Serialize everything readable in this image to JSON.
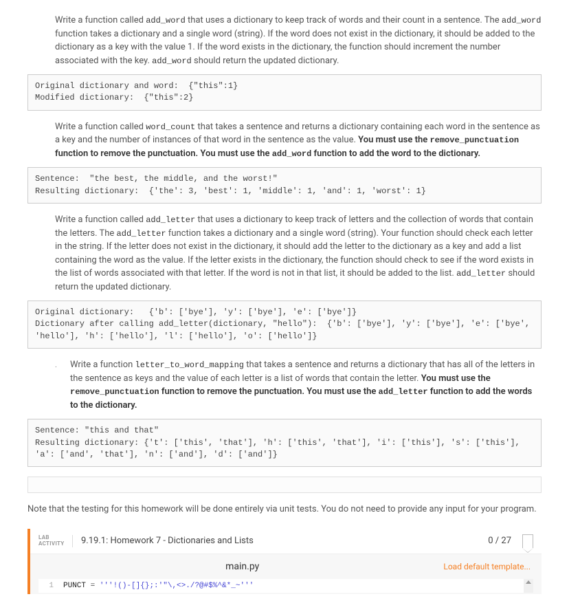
{
  "task1": {
    "text_pre1": "Write a function called ",
    "fn": "add_word",
    "text_mid1": " that uses a dictionary to keep track of words and their count in a sentence. The ",
    "fn2": "add_word",
    "text_mid2": " function takes a dictionary and a single word (string). If the word does not exist in the dictionary, it should be added to the dictionary as a key with the value 1. If the word exists in the dictionary, the function should increment the number associated with the key. ",
    "fn3": "add_word",
    "text_post": " should return the updated dictionary."
  },
  "code1": "Original dictionary and word:  {\"this\":1}\nModified dictionary:  {\"this\":2}",
  "task2": {
    "text_pre": "Write a function called ",
    "fn": "word_count",
    "text_mid1": " that takes a sentence and returns a dictionary containing each word in the sentence as a key and the number of instances of that word in the sentence as the value. ",
    "bold1": "You must use the ",
    "fn2": "remove_punctuation",
    "bold1b": " function to remove the punctuation. You must use the ",
    "fn3": "add_word",
    "bold1c": " function to add the word to the dictionary."
  },
  "code2": "Sentence:  \"the best, the middle, and the worst!\"\nResulting dictionary:  {'the': 3, 'best': 1, 'middle': 1, 'and': 1, 'worst': 1}",
  "task3": {
    "text_pre": "Write a function called ",
    "fn": "add_letter",
    "text_mid1": " that uses a dictionary to keep track of letters and the collection of words that contain the letters. The ",
    "fn2": "add_letter",
    "text_mid2": " function takes a dictionary and a single word (string). Your function should check each letter in the string. If the letter does not exist in the dictionary, it should add the letter to the dictionary as a key and add a list containing the word as the value. If the letter exists in the dictionary, the function should check to see if the word exists in the list of words associated with that letter. If the word is not in that list, it should be added to the list. ",
    "fn3": "add_letter",
    "text_post": " should return the updated dictionary."
  },
  "code3": "Original dictionary:   {'b': ['bye'], 'y': ['bye'], 'e': ['bye']}\nDictionary after calling add_letter(dictionary, \"hello\"):  {'b': ['bye'], 'y': ['bye'], 'e': ['bye', 'hello'], 'h': ['hello'], 'l': ['hello'], 'o': ['hello']}",
  "task4": {
    "marker": ".",
    "text_pre": "Write a function ",
    "fn": "letter_to_word_mapping",
    "text_mid1": " that takes a sentence and returns a dictionary that has all of the letters in the sentence as keys and the value of each letter is a list of words that contain the letter. ",
    "bold1": "You must use the ",
    "fn2": "remove_punctuation",
    "bold1b": " function to remove the punctuation. You must use the ",
    "fn3": "add_letter",
    "bold1c": " function to add the words to the dictionary."
  },
  "code4": "Sentence: \"this and that\"\nResulting dictionary: {'t': ['this', 'that'], 'h': ['this', 'that'], 'i': ['this'], 's': ['this'], 'a': ['and', 'that'], 'n': ['and'], 'd': ['and']}",
  "note": "Note that the testing for this homework will be done entirely via unit tests. You do not need to provide any input for your program.",
  "lab": {
    "activity_label": "LAB ACTIVITY",
    "title": "9.19.1: Homework 7 - Dictionaries and Lists",
    "score": "0 / 27",
    "filename": "main.py",
    "load_template": "Load default template...",
    "line1_num": "1",
    "line1_var": "PUNCT",
    "line1_eq": " = ",
    "line1_str": "'''!()-[]{};:'\"\\,<>./?@#$%^&*_~'''"
  }
}
